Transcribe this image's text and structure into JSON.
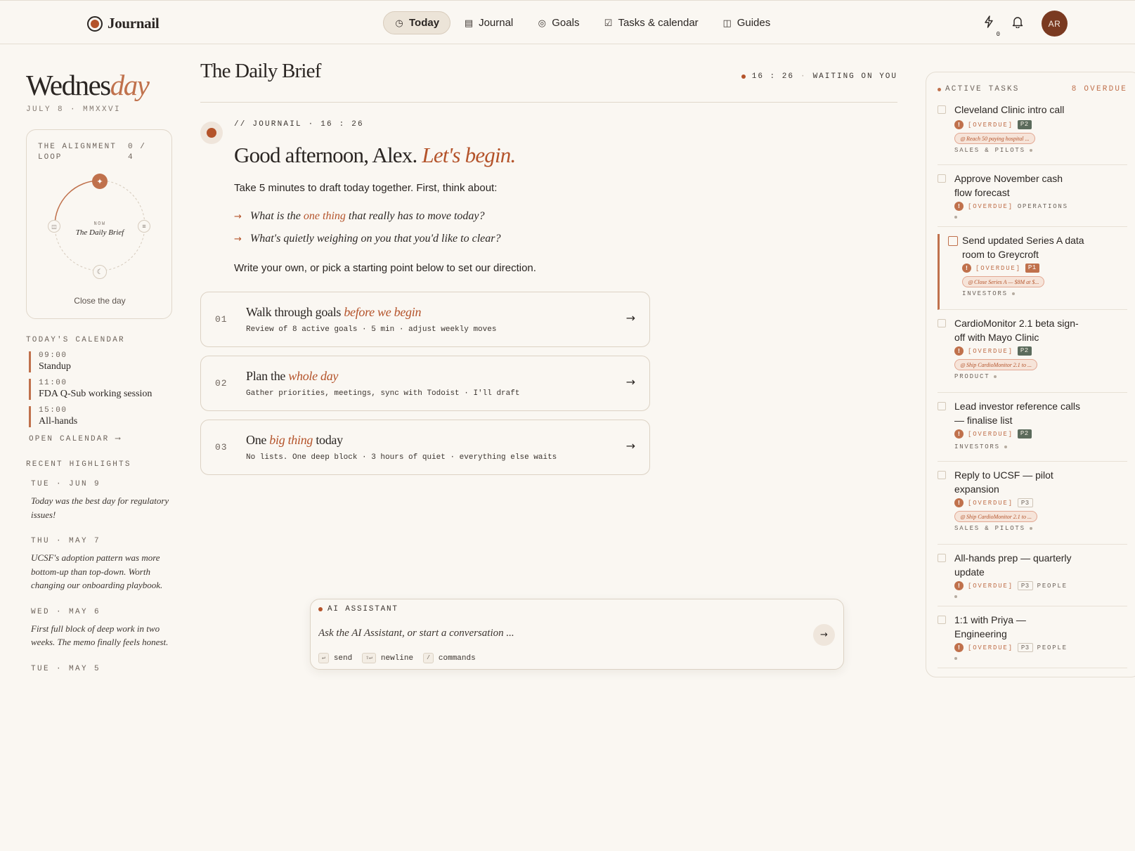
{
  "app": {
    "name": "Journail"
  },
  "nav": [
    {
      "label": "Today",
      "icon": "clock-icon",
      "glyph": "◷"
    },
    {
      "label": "Journal",
      "icon": "journal-icon",
      "glyph": "▤"
    },
    {
      "label": "Goals",
      "icon": "target-icon",
      "glyph": "◎"
    },
    {
      "label": "Tasks & calendar",
      "icon": "calendar-check-icon",
      "glyph": "☑"
    },
    {
      "label": "Guides",
      "icon": "book-icon",
      "glyph": "◫"
    }
  ],
  "header": {
    "lightning_count": "0",
    "avatar_initials": "AR"
  },
  "day": {
    "weekday_main": "Wednes",
    "weekday_suffix": "day",
    "date": "JULY 8 · MMXXVI"
  },
  "loop": {
    "title": "THE ALIGNMENT LOOP",
    "count": "0 / 4",
    "now_label": "NOW",
    "current": "The Daily Brief",
    "close": "Close the day"
  },
  "calendar": {
    "heading": "TODAY'S CALENDAR",
    "events": [
      {
        "time": "09:00",
        "title": "Standup"
      },
      {
        "time": "11:00",
        "title": "FDA Q-Sub working session"
      },
      {
        "time": "15:00",
        "title": "All-hands"
      }
    ],
    "open": "OPEN CALENDAR ⟶"
  },
  "highlights": {
    "heading": "RECENT HIGHLIGHTS",
    "items": [
      {
        "date": "TUE · JUN 9",
        "text": "Today was the best day for regulatory issues!"
      },
      {
        "date": "THU · MAY 7",
        "text": "UCSF's adoption pattern was more bottom-up than top-down. Worth changing our onboarding playbook."
      },
      {
        "date": "WED · MAY 6",
        "text": "First full block of deep work in two weeks. The memo finally feels honest."
      },
      {
        "date": "TUE · MAY 5",
        "text": ""
      }
    ]
  },
  "brief": {
    "title": "The Daily Brief",
    "status_time": "16 : 26",
    "status_text": "WAITING ON YOU",
    "meta": "// JOURNAIL · 16 : 26",
    "greeting_plain": "Good afternoon, Alex.",
    "greeting_em": "Let's begin.",
    "intro": "Take 5 minutes to draft today together. First, think about:",
    "q1_pre": "What is the",
    "q1_em": "one thing",
    "q1_post": "that really has to move today?",
    "q2": "What's quietly weighing on you that you'd like to clear?",
    "outro": "Write your own, or pick a starting point below to set our direction."
  },
  "options": [
    {
      "num": "01",
      "title_plain": "Walk through goals",
      "title_em": "before we begin",
      "title_after": "",
      "sub": "Review of 8 active goals · 5 min · adjust weekly moves"
    },
    {
      "num": "02",
      "title_plain": "Plan the",
      "title_em": "whole day",
      "title_after": "",
      "sub": "Gather priorities, meetings, sync with Todoist · I'll draft"
    },
    {
      "num": "03",
      "title_plain": "One",
      "title_em": "big thing",
      "title_after": "today",
      "sub": "No lists. One deep block · 3 hours of quiet · everything else waits"
    }
  ],
  "assistant": {
    "label": "AI ASSISTANT",
    "placeholder": "Ask the AI Assistant, or start a conversation ...",
    "hint_send_key": "↵",
    "hint_send": "send",
    "hint_newline_key": "⇧↵",
    "hint_newline": "newline",
    "hint_cmd_key": "/",
    "hint_cmd": "commands"
  },
  "tasks": {
    "heading": "ACTIVE TASKS",
    "overdue_count": "8 OVERDUE",
    "overdue_label": "[OVERDUE]",
    "items": [
      {
        "title": "Cleveland Clinic intro call",
        "priority": "P2",
        "goal": "◎ Reach 50 paying hospital ...",
        "category": "SALES & PILOTS"
      },
      {
        "title": "Approve November cash flow forecast",
        "priority": "",
        "goal": "",
        "category": "OPERATIONS"
      },
      {
        "title": "Send updated Series A data room to Greycroft",
        "priority": "P1",
        "goal": "◎ Close Series A — $8M at $...",
        "category": "INVESTORS"
      },
      {
        "title": "CardioMonitor 2.1 beta sign-off with Mayo Clinic",
        "priority": "P2",
        "goal": "◎ Ship CardioMonitor 2.1 to ...",
        "category": "PRODUCT"
      },
      {
        "title": "Lead investor reference calls — finalise list",
        "priority": "P2",
        "goal": "",
        "category": "INVESTORS"
      },
      {
        "title": "Reply to UCSF — pilot expansion",
        "priority": "P3",
        "goal": "◎ Ship CardioMonitor 2.1 to ...",
        "category": "SALES & PILOTS"
      },
      {
        "title": "All-hands prep — quarterly update",
        "priority": "P3",
        "goal": "",
        "category": "PEOPLE"
      },
      {
        "title": "1:1 with Priya — Engineering",
        "priority": "P3",
        "goal": "",
        "category": "PEOPLE"
      }
    ]
  },
  "colors": {
    "accent": "#b4532a",
    "accent_soft": "#c0714c",
    "background": "#faf7f2",
    "p2": "#5b6b5c"
  }
}
